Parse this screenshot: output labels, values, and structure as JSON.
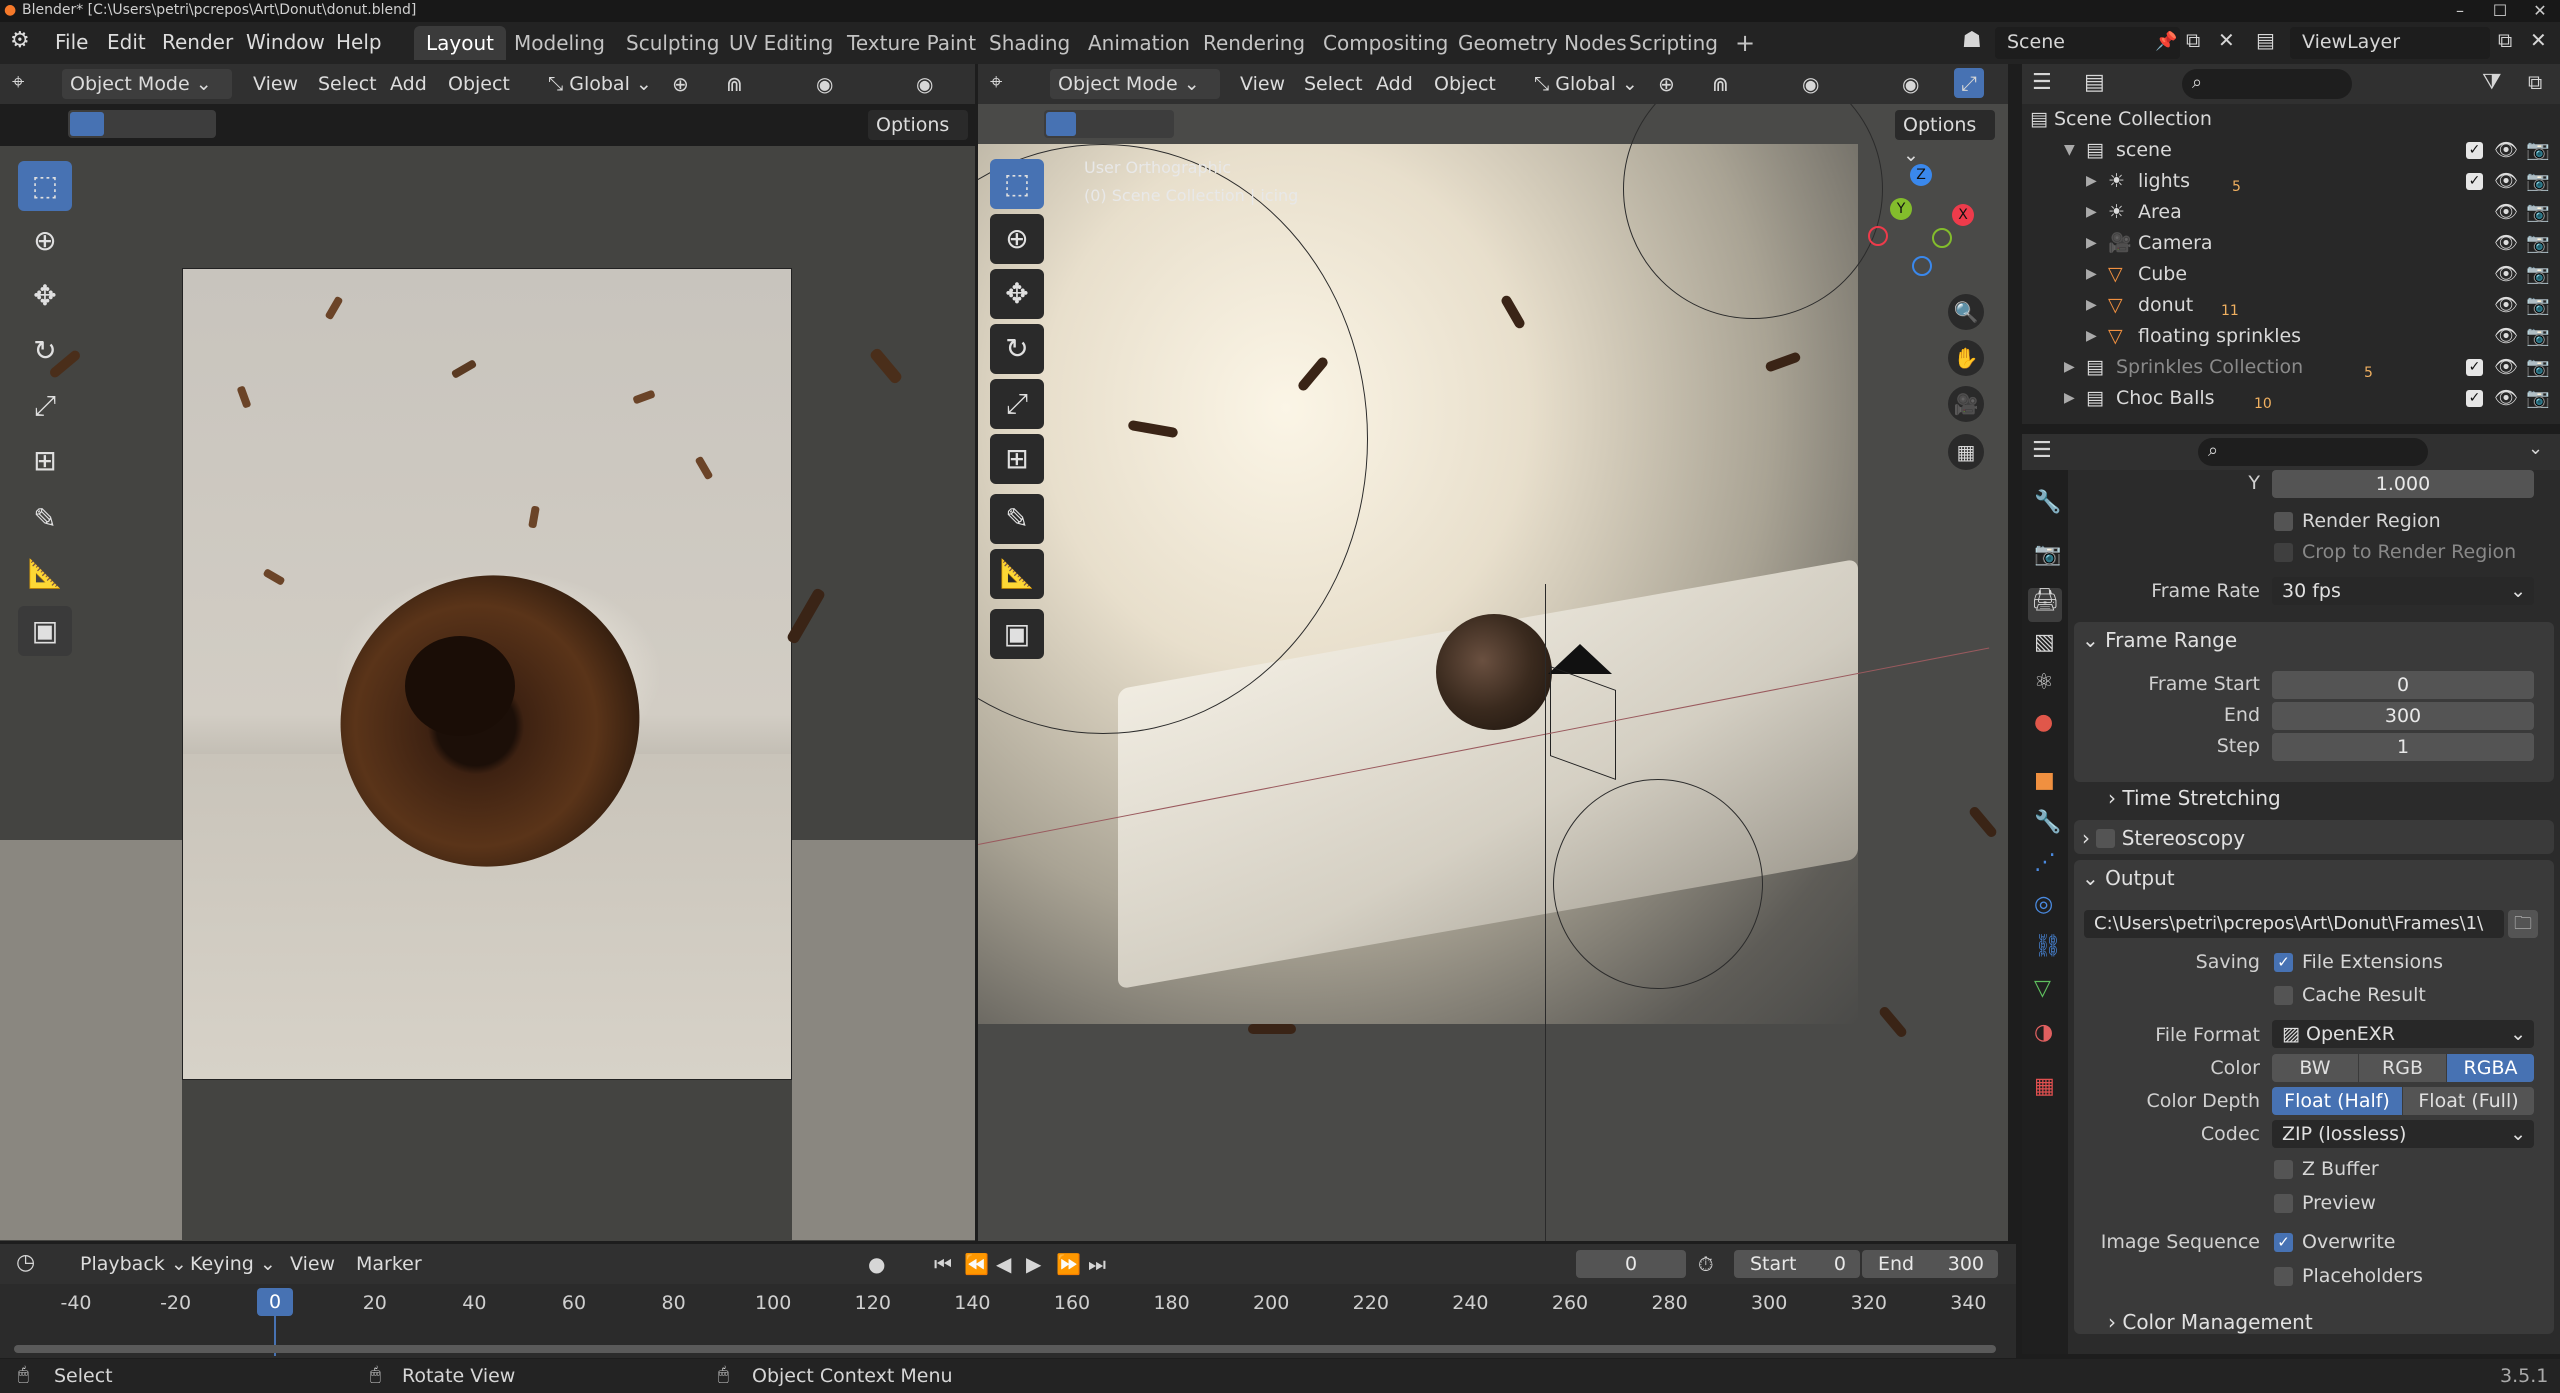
{
  "title_bar": {
    "text": "Blender* [C:\\Users\\petri\\pcrepos\\Art\\Donut\\donut.blend]"
  },
  "menus": [
    "File",
    "Edit",
    "Render",
    "Window",
    "Help"
  ],
  "workspaces": [
    "Layout",
    "Modeling",
    "Sculpting",
    "UV Editing",
    "Texture Paint",
    "Shading",
    "Animation",
    "Rendering",
    "Compositing",
    "Geometry Nodes",
    "Scripting"
  ],
  "active_workspace": "Layout",
  "scene": {
    "name": "Scene",
    "view_layer": "ViewLayer"
  },
  "left_viewport": {
    "mode": "Object Mode",
    "menu": [
      "View",
      "Select",
      "Add",
      "Object"
    ],
    "orientation": "Global",
    "options": "Options"
  },
  "right_viewport": {
    "mode": "Object Mode",
    "menu": [
      "View",
      "Select",
      "Add",
      "Object"
    ],
    "orientation": "Global",
    "options": "Options",
    "overlay_line1": "User Orthographic",
    "overlay_line2": "(0) Scene Collection | icing",
    "gizmo": {
      "x": "X",
      "y": "Y",
      "z": "Z"
    }
  },
  "outliner": {
    "root": "Scene Collection",
    "items": [
      {
        "name": "scene",
        "indent": 1,
        "expanded": true,
        "badge": "",
        "checkbox": true
      },
      {
        "name": "lights",
        "indent": 2,
        "badge": "5",
        "checkbox": true
      },
      {
        "name": "Area",
        "indent": 2,
        "badge": "",
        "checkbox": false
      },
      {
        "name": "Camera",
        "indent": 2,
        "badge": "",
        "checkbox": false
      },
      {
        "name": "Cube",
        "indent": 2,
        "badge": "",
        "checkbox": false
      },
      {
        "name": "donut",
        "indent": 2,
        "badge": "11",
        "checkbox": false
      },
      {
        "name": "floating sprinkles",
        "indent": 2,
        "badge": "",
        "checkbox": false
      },
      {
        "name": "Sprinkles Collection",
        "indent": 1,
        "badge": "5",
        "checkbox": true,
        "dim": true
      },
      {
        "name": "Choc Balls",
        "indent": 1,
        "badge": "10",
        "checkbox": true
      }
    ]
  },
  "properties": {
    "resolution_y_label": "Y",
    "resolution_y": "1.000",
    "render_region": "Render Region",
    "crop_region": "Crop to Render Region",
    "frame_rate_label": "Frame Rate",
    "frame_rate": "30 fps",
    "frame_range": {
      "title": "Frame Range",
      "start_label": "Frame Start",
      "start": "0",
      "end_label": "End",
      "end": "300",
      "step_label": "Step",
      "step": "1"
    },
    "time_stretching": "Time Stretching",
    "stereoscopy": "Stereoscopy",
    "output": {
      "title": "Output",
      "path": "C:\\Users\\petri\\pcrepos\\Art\\Donut\\Frames\\1\\",
      "saving_label": "Saving",
      "file_extensions": "File Extensions",
      "cache_result": "Cache Result",
      "file_format_label": "File Format",
      "file_format": "OpenEXR",
      "color_label": "Color",
      "color_options": [
        "BW",
        "RGB",
        "RGBA"
      ],
      "color_selected": "RGBA",
      "color_depth_label": "Color Depth",
      "depth_options": [
        "Float (Half)",
        "Float (Full)"
      ],
      "depth_selected": "Float (Half)",
      "codec_label": "Codec",
      "codec": "ZIP (lossless)",
      "z_buffer": "Z Buffer",
      "preview": "Preview",
      "image_sequence_label": "Image Sequence",
      "overwrite": "Overwrite",
      "placeholders": "Placeholders"
    },
    "color_management": "Color Management"
  },
  "timeline": {
    "menu": [
      "Playback",
      "Keying",
      "View",
      "Marker"
    ],
    "current_frame": "0",
    "start_label": "Start",
    "start": "0",
    "end_label": "End",
    "end": "300",
    "ticks": [
      "-40",
      "-20",
      "0",
      "20",
      "40",
      "60",
      "80",
      "100",
      "120",
      "140",
      "160",
      "180",
      "200",
      "220",
      "240",
      "260",
      "280",
      "300",
      "320",
      "340"
    ]
  },
  "status_bar": {
    "select": "Select",
    "rotate": "Rotate View",
    "context": "Object Context Menu",
    "version": "3.5.1"
  },
  "colors": {
    "accent": "#4772b3",
    "header": "#303030",
    "panel": "#2b2b2b",
    "axis_x": "#ee3b4b",
    "axis_y": "#83bd2c",
    "axis_z": "#3a88ec"
  }
}
